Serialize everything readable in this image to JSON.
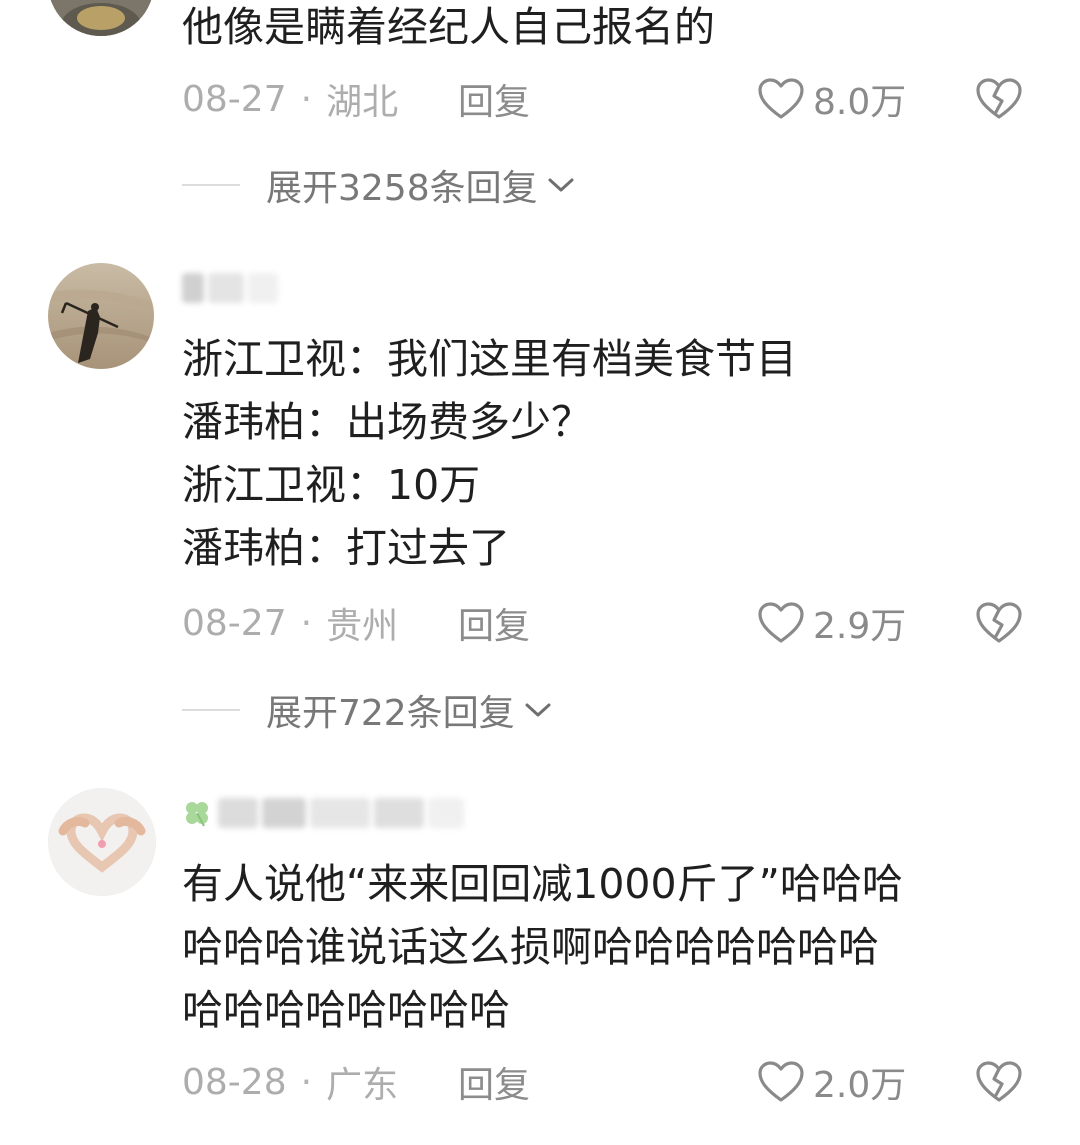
{
  "comments": [
    {
      "text_lines": [
        "他像是瞒着经纪人自己报名的"
      ],
      "date": "08-27",
      "separator": "·",
      "region": "湖北",
      "reply_label": "回复",
      "likes": "8.0万",
      "expand_label": "展开3258条回复"
    },
    {
      "text_lines": [
        "浙江卫视：我们这里有档美食节目",
        "潘玮柏：出场费多少？",
        "浙江卫视：10万",
        "潘玮柏：打过去了"
      ],
      "date": "08-27",
      "separator": "·",
      "region": "贵州",
      "reply_label": "回复",
      "likes": "2.9万",
      "expand_label": "展开722条回复"
    },
    {
      "text_lines": [
        "有人说他“来来回回减1000斤了”哈哈哈",
        "哈哈哈谁说话这么损啊哈哈哈哈哈哈哈",
        "哈哈哈哈哈哈哈哈"
      ],
      "date": "08-28",
      "separator": "·",
      "region": "广东",
      "reply_label": "回复",
      "likes": "2.0万"
    }
  ],
  "icons": {
    "like": "heart-outline-icon",
    "dislike": "broken-heart-icon",
    "expand": "chevron-down-icon",
    "username_badge": "four-leaf-clover-icon"
  },
  "colors": {
    "text": "#1f1f1f",
    "meta": "#adadad",
    "reply": "#8c8c8c",
    "icon": "#8a8a8a"
  }
}
